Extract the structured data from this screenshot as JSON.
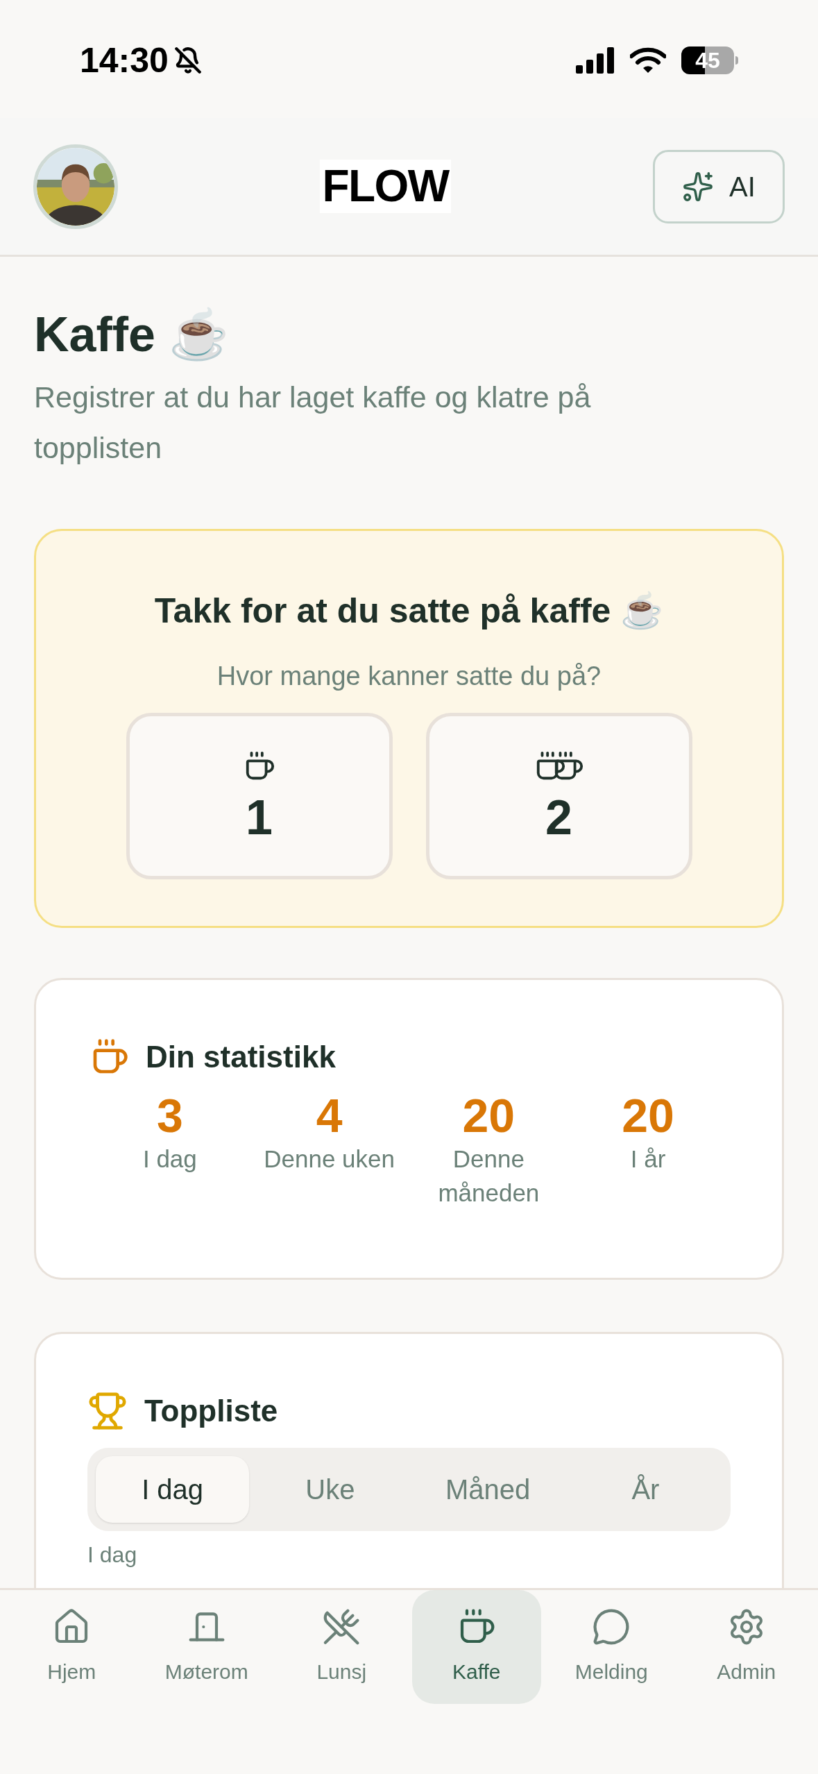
{
  "status_bar": {
    "time": "14:30",
    "silent": true,
    "battery": "45"
  },
  "header": {
    "logo": "FLOW",
    "ai_button": "AI"
  },
  "page": {
    "title": "Kaffe ☕",
    "subtitle": "Registrer at du har laget kaffe og klatre på topplisten"
  },
  "brew_card": {
    "title": "Takk for at du satte på kaffe ☕",
    "question": "Hvor mange kanner satte du på?",
    "options": [
      {
        "kind": "cup",
        "value": "1"
      },
      {
        "kind": "cups",
        "value": "2"
      }
    ]
  },
  "stats": {
    "title": "Din statistikk",
    "items": [
      {
        "value": "3",
        "label": "I dag"
      },
      {
        "value": "4",
        "label": "Denne uken"
      },
      {
        "value": "20",
        "label": "Denne måneden"
      },
      {
        "value": "20",
        "label": "I år"
      }
    ]
  },
  "leaderboard": {
    "title": "Toppliste",
    "tabs": [
      {
        "label": "I dag",
        "selected": true
      },
      {
        "label": "Uke",
        "selected": false
      },
      {
        "label": "Måned",
        "selected": false
      },
      {
        "label": "År",
        "selected": false
      }
    ],
    "section_label": "I dag"
  },
  "nav": [
    {
      "kind": "home",
      "label": "Hjem",
      "selected": false
    },
    {
      "kind": "door",
      "label": "Møterom",
      "selected": false
    },
    {
      "kind": "utensils",
      "label": "Lunsj",
      "selected": false
    },
    {
      "kind": "coffee",
      "label": "Kaffe",
      "selected": true
    },
    {
      "kind": "chat",
      "label": "Melding",
      "selected": false
    },
    {
      "kind": "gear",
      "label": "Admin",
      "selected": false
    }
  ]
}
